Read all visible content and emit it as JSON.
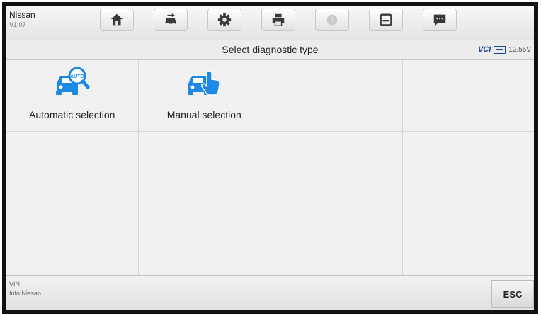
{
  "vehicle": {
    "make": "Nissan",
    "version": "V1.07"
  },
  "toolbar": {
    "buttons": [
      {
        "icon": "home-icon"
      },
      {
        "icon": "vehicle-swap-icon"
      },
      {
        "icon": "settings-gear-icon"
      },
      {
        "icon": "print-icon"
      },
      {
        "icon": "help-icon",
        "disabled": true
      },
      {
        "icon": "save-icon"
      },
      {
        "icon": "data-logging-icon"
      }
    ]
  },
  "header": {
    "title": "Select diagnostic type"
  },
  "status": {
    "vci_label": "VCI",
    "voltage": "12.55V"
  },
  "tiles": [
    {
      "label": "Automatic selection",
      "icon": "car-auto-search-icon"
    },
    {
      "label": "Manual selection",
      "icon": "car-manual-select-icon"
    }
  ],
  "footer": {
    "vin": "VIN:",
    "info": "Info:Nissan",
    "esc_label": "ESC"
  },
  "colors": {
    "accent": "#1e88e5",
    "icon_dark": "#3a3a3a"
  }
}
